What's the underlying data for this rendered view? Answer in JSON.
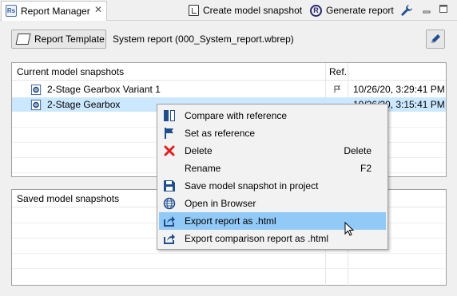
{
  "view": {
    "tab_title": "Report Manager",
    "tab_icon_text": "Rs",
    "close_glyph": "✕",
    "toolbar": {
      "create_snapshot_label": "Create model snapshot",
      "generate_report_label": "Generate report",
      "generate_report_icon_text": "R"
    }
  },
  "report": {
    "template_button_label": "Report Template",
    "system_text": "System report (000_System_report.wbrep)"
  },
  "current_table": {
    "headers": [
      "Current model snapshots",
      "Ref.",
      ""
    ],
    "rows": [
      {
        "name": "2-Stage Gearbox Variant 1",
        "ref": "flag",
        "date": "10/26/20, 3:29:41 PM"
      },
      {
        "name": "2-Stage Gearbox",
        "ref": "",
        "date": "10/26/20, 3:15:41 PM"
      }
    ]
  },
  "saved_table": {
    "headers": [
      "Saved model snapshots"
    ]
  },
  "context_menu": {
    "items": [
      {
        "label": "Compare with reference",
        "icon": "compare-icon",
        "shortcut": ""
      },
      {
        "label": "Set as reference",
        "icon": "flag-icon",
        "shortcut": ""
      },
      {
        "label": "Delete",
        "icon": "delete-icon",
        "shortcut": "Delete"
      },
      {
        "label": "Rename",
        "icon": "",
        "shortcut": "F2"
      },
      {
        "label": "Save model snapshot in project",
        "icon": "save-icon",
        "shortcut": ""
      },
      {
        "label": "Open in Browser",
        "icon": "globe-icon",
        "shortcut": ""
      },
      {
        "label": "Export report as .html",
        "icon": "export-icon",
        "shortcut": ""
      },
      {
        "label": "Export comparison report as .html",
        "icon": "export-icon",
        "shortcut": ""
      }
    ],
    "highlighted_index": 6
  },
  "colors": {
    "selection": "#cce8ff",
    "menu_highlight": "#91c9f7",
    "delete_red": "#e02020",
    "icon_blue": "#1f4e8c"
  }
}
